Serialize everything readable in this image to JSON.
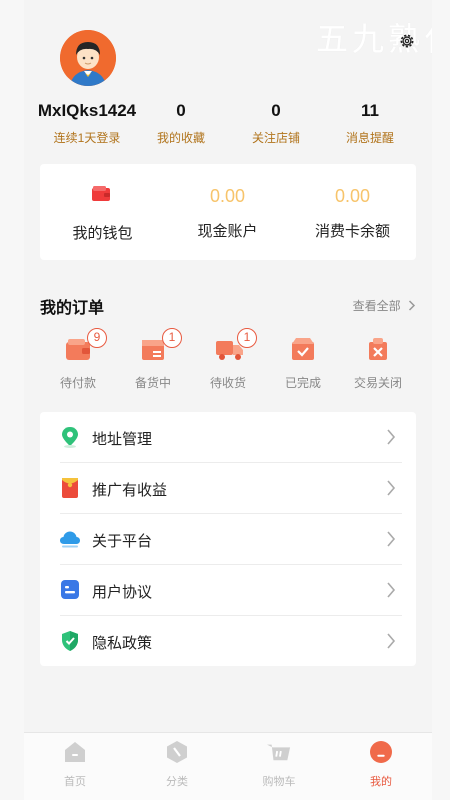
{
  "watermark": "五九熟化",
  "profile": {
    "username": "MxIQks1424",
    "login_streak": "连续1天登录"
  },
  "stats": [
    {
      "value": "0",
      "label": "我的收藏"
    },
    {
      "value": "0",
      "label": "关注店铺"
    },
    {
      "value": "11",
      "label": "消息提醒"
    }
  ],
  "wallet": {
    "my_wallet": "我的钱包",
    "cash_value": "0.00",
    "cash_label": "现金账户",
    "card_value": "0.00",
    "card_label": "消费卡余额"
  },
  "orders": {
    "title": "我的订单",
    "view_all": "查看全部",
    "items": [
      {
        "label": "待付款",
        "badge": "9",
        "icon": "wallet-icon"
      },
      {
        "label": "备货中",
        "badge": "1",
        "icon": "package-icon"
      },
      {
        "label": "待收货",
        "badge": "1",
        "icon": "truck-icon"
      },
      {
        "label": "已完成",
        "icon": "box-check-icon"
      },
      {
        "label": "交易关闭",
        "icon": "close-bag-icon"
      }
    ]
  },
  "menu": [
    {
      "label": "地址管理",
      "icon": "location-pin-icon"
    },
    {
      "label": "推广有收益",
      "icon": "red-envelope-icon"
    },
    {
      "label": "关于平台",
      "icon": "cloud-icon"
    },
    {
      "label": "用户协议",
      "icon": "document-icon"
    },
    {
      "label": "隐私政策",
      "icon": "shield-icon"
    }
  ],
  "tabs": [
    {
      "label": "首页",
      "icon": "home-icon"
    },
    {
      "label": "分类",
      "icon": "category-icon"
    },
    {
      "label": "购物车",
      "icon": "cart-icon"
    },
    {
      "label": "我的",
      "icon": "profile-icon",
      "active": true
    }
  ],
  "colors": {
    "accent": "#e85a40",
    "gold_label": "#b1741c",
    "balance": "#f7c46b"
  }
}
